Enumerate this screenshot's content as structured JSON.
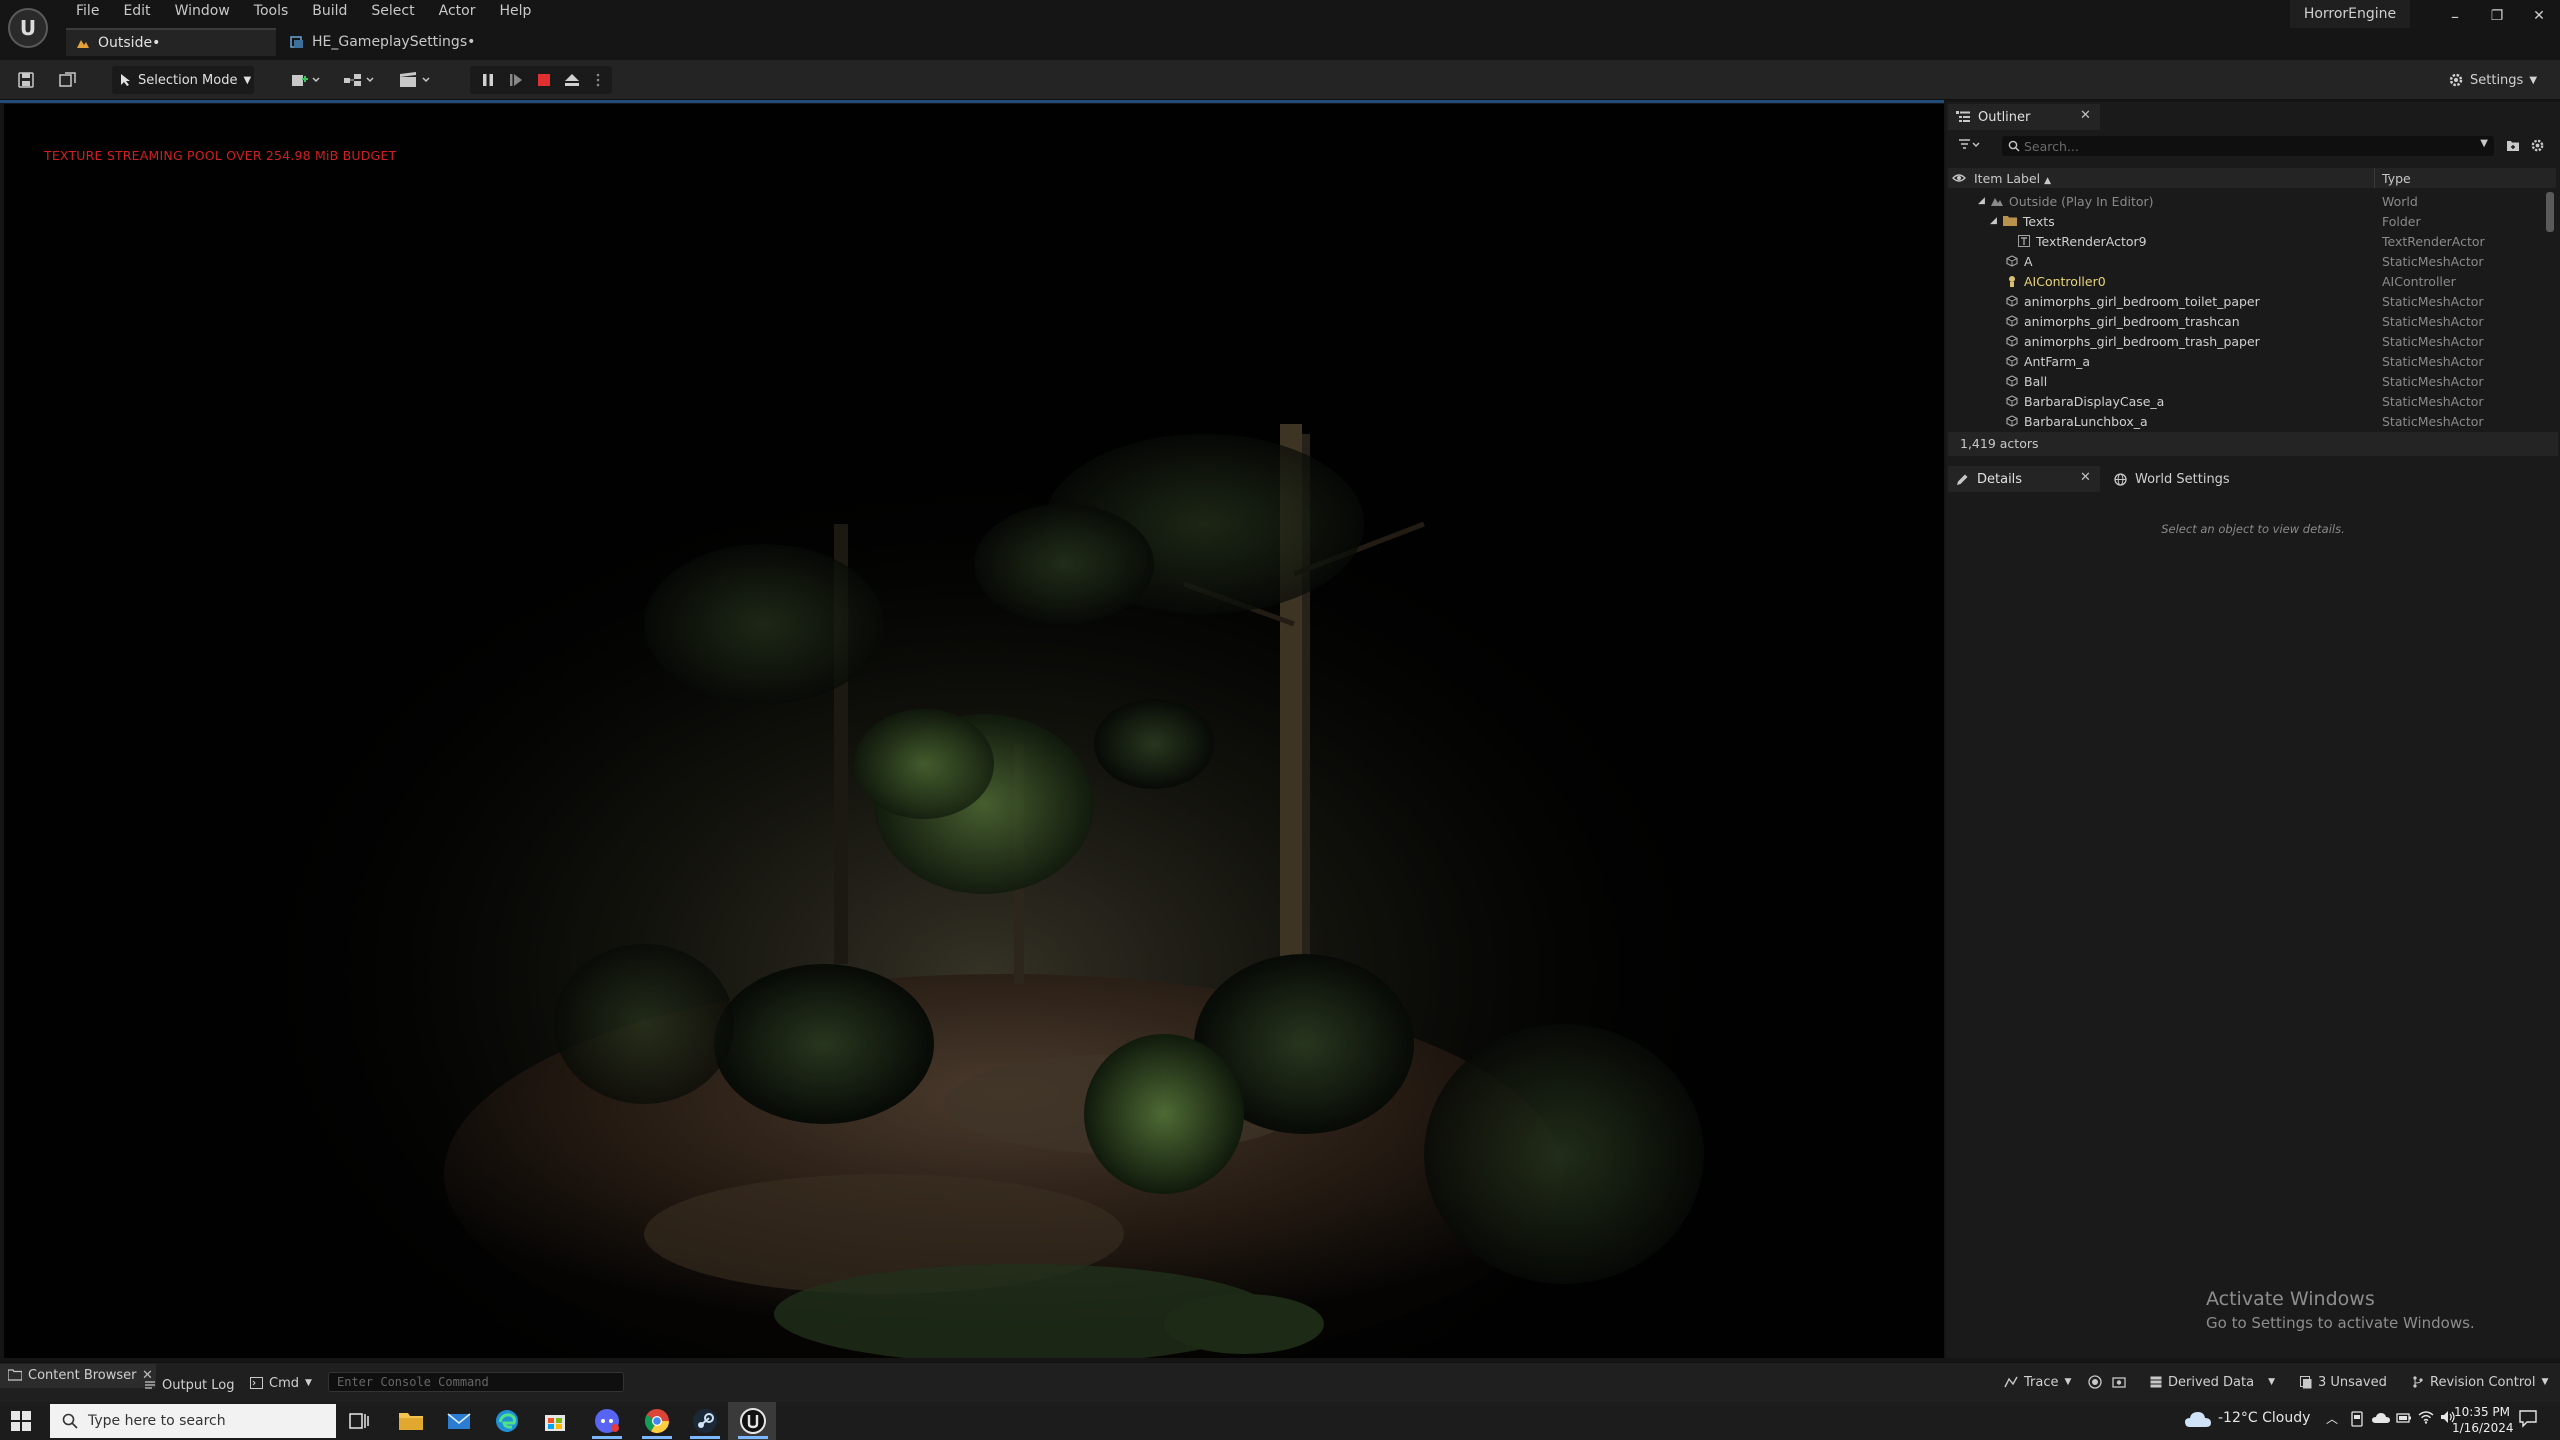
{
  "app": {
    "title": "HorrorEngine",
    "logo_glyph": "U",
    "menus": [
      "File",
      "Edit",
      "Window",
      "Tools",
      "Build",
      "Select",
      "Actor",
      "Help"
    ],
    "window_controls": [
      "–",
      "❐",
      "✕"
    ]
  },
  "tabs": [
    {
      "label": "Outside•"
    },
    {
      "label": "HE_GameplaySettings•"
    }
  ],
  "toolbar": {
    "selection_mode": "Selection Mode",
    "settings_label": "Settings",
    "stop_color": "#e23030"
  },
  "viewport": {
    "warning": "TEXTURE STREAMING POOL OVER 254.98 MiB BUDGET",
    "warning_color": "#d12020"
  },
  "outliner": {
    "tab_label": "Outliner",
    "search_placeholder": "Search...",
    "col_label": "Item Label",
    "col_type": "Type",
    "rows": [
      {
        "label": "Outside (Play In Editor)",
        "type": "World",
        "icon": "world-icon"
      },
      {
        "label": "Texts",
        "type": "Folder",
        "icon": "folder-icon"
      },
      {
        "label": "TextRenderActor9",
        "type": "TextRenderActor",
        "icon": "text-render-icon"
      },
      {
        "label": "A",
        "type": "StaticMeshActor",
        "icon": "static-mesh-icon"
      },
      {
        "label": "AIController0",
        "type": "AIController",
        "icon": "ai-controller-icon"
      },
      {
        "label": "animorphs_girl_bedroom_toilet_paper",
        "type": "StaticMeshActor",
        "icon": "static-mesh-icon"
      },
      {
        "label": "animorphs_girl_bedroom_trashcan",
        "type": "StaticMeshActor",
        "icon": "static-mesh-icon"
      },
      {
        "label": "animorphs_girl_bedroom_trash_paper",
        "type": "StaticMeshActor",
        "icon": "static-mesh-icon"
      },
      {
        "label": "AntFarm_a",
        "type": "StaticMeshActor",
        "icon": "static-mesh-icon"
      },
      {
        "label": "Ball",
        "type": "StaticMeshActor",
        "icon": "static-mesh-icon"
      },
      {
        "label": "BarbaraDisplayCase_a",
        "type": "StaticMeshActor",
        "icon": "static-mesh-icon"
      },
      {
        "label": "BarbaraLunchbox_a",
        "type": "StaticMeshActor",
        "icon": "static-mesh-icon"
      }
    ],
    "actor_count": "1,419 actors"
  },
  "details": {
    "tab_label": "Details",
    "world_settings_label": "World Settings",
    "hint": "Select an object to view details."
  },
  "watermark": {
    "title": "Activate Windows",
    "subtitle": "Go to Settings to activate Windows."
  },
  "statusbar": {
    "content_browser": "Content Browser",
    "output_log": "Output Log",
    "cmd": "Cmd",
    "console_placeholder": "Enter Console Command",
    "trace": "Trace",
    "derived_data": "Derived Data",
    "unsaved": "3 Unsaved",
    "revision_control": "Revision Control"
  },
  "taskbar": {
    "search_placeholder": "Type here to search",
    "weather": "-12°C  Cloudy",
    "time": "10:35 PM",
    "date": "1/16/2024"
  }
}
